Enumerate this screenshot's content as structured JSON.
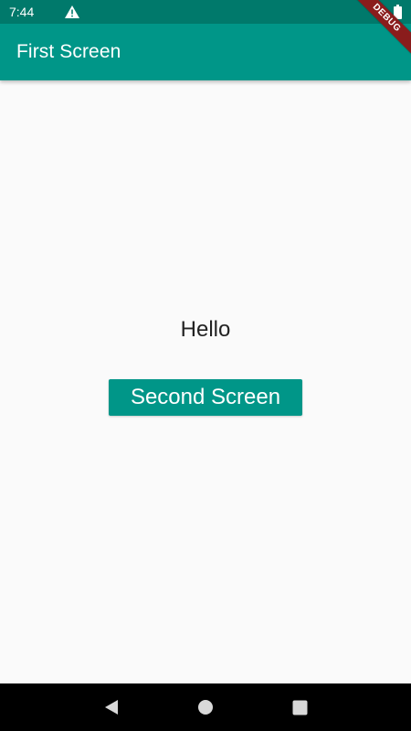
{
  "status_bar": {
    "time": "7:44",
    "warning_icon": "warning-icon",
    "battery_icon": "battery-icon"
  },
  "app_bar": {
    "title": "First Screen",
    "color": "#009688"
  },
  "main": {
    "greeting": "Hello",
    "button_label": "Second Screen",
    "button_color": "#009688"
  },
  "debug_banner": {
    "label": "DEBUG",
    "color": "#8a1c1c"
  },
  "nav_bar": {
    "back_icon": "back-triangle-icon",
    "home_icon": "home-circle-icon",
    "recents_icon": "recents-square-icon"
  }
}
